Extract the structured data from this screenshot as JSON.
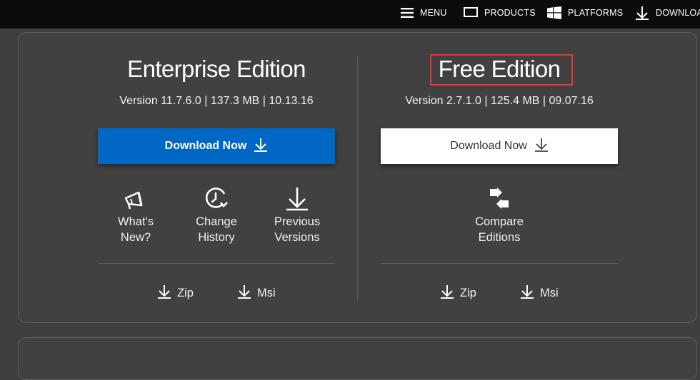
{
  "nav": {
    "menu": "MENU",
    "products": "PRODUCTS",
    "platforms": "PLATFORMS",
    "download": "DOWNLOAD"
  },
  "enterprise": {
    "title": "Enterprise Edition",
    "version": "Version 11.7.6.0 | 137.3 MB | 10.13.16",
    "download_label": "Download Now",
    "features": [
      {
        "label_line1": "What's",
        "label_line2": "New?",
        "icon": "megaphone-icon"
      },
      {
        "label_line1": "Change",
        "label_line2": "History",
        "icon": "history-clock-icon"
      },
      {
        "label_line1": "Previous",
        "label_line2": "Versions",
        "icon": "download-arrow-icon"
      }
    ],
    "packages": [
      "Zip",
      "Msi"
    ]
  },
  "free": {
    "title": "Free Edition",
    "version": "Version 2.7.1.0 | 125.4 MB | 09.07.16",
    "download_label": "Download Now",
    "features": [
      {
        "label_line1": "Compare",
        "label_line2": "Editions",
        "icon": "compare-arrows-icon"
      }
    ],
    "packages": [
      "Zip",
      "Msi"
    ]
  },
  "colors": {
    "nav_bg": "#0c0c0c",
    "page_bg": "#3f3f3f",
    "primary_button": "#0067c5",
    "secondary_button": "#ffffff",
    "highlight": "#e53935"
  }
}
